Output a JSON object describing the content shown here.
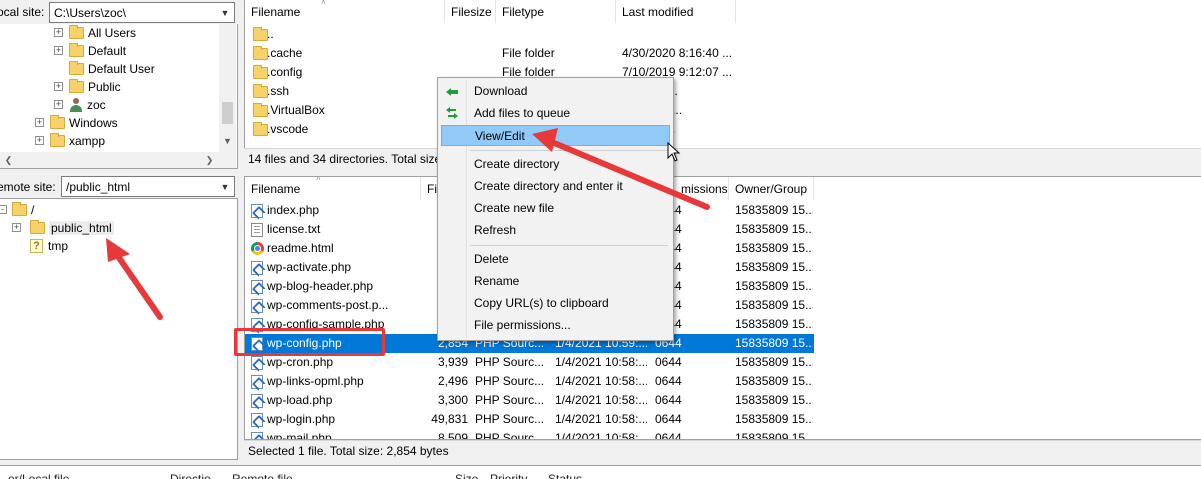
{
  "local": {
    "label": "ocal site:",
    "path": "C:\\Users\\zoc\\",
    "tree": [
      {
        "label": "All Users",
        "icon": "folder-icon",
        "expander": "+"
      },
      {
        "label": "Default",
        "icon": "folder-icon",
        "expander": "+"
      },
      {
        "label": "Default User",
        "icon": "folder-icon",
        "expander": ""
      },
      {
        "label": "Public",
        "icon": "folder-icon",
        "expander": "+"
      },
      {
        "label": "zoc",
        "icon": "user-icon",
        "expander": "+"
      },
      {
        "label": "Windows",
        "icon": "folder-icon",
        "expander": "+"
      },
      {
        "label": "xampp",
        "icon": "folder-icon",
        "expander": "+"
      }
    ],
    "list_headers": [
      "Filename",
      "Filesize",
      "Filetype",
      "Last modified"
    ],
    "files": [
      {
        "name": "..",
        "size": "",
        "type": "",
        "modified": ""
      },
      {
        "name": ".cache",
        "size": "",
        "type": "File folder",
        "modified": "4/30/2020 8:16:40 ..."
      },
      {
        "name": ".config",
        "size": "",
        "type": "File folder",
        "modified": "7/10/2019 9:12:07 ..."
      },
      {
        "name": ".ssh",
        "size": "",
        "type": "",
        "modified": "11:42:46..."
      },
      {
        "name": ".VirtualBox",
        "size": "",
        "type": "",
        "modified": "0 2:59:51..."
      },
      {
        "name": ".vscode",
        "size": "",
        "type": "",
        "modified": "9:14:20 ..."
      }
    ],
    "status": "14 files and 34 directories. Total size:"
  },
  "remote": {
    "label": "emote site:",
    "path": "/public_html",
    "tree": [
      {
        "label": "/",
        "icon": "folder-icon",
        "expander": "-"
      },
      {
        "label": "public_html",
        "icon": "folder-icon",
        "expander": "+"
      },
      {
        "label": "tmp",
        "icon": "unknown-icon",
        "expander": ""
      }
    ],
    "list_headers": [
      "Filename",
      "Fi",
      "",
      "missions",
      "Owner/Group"
    ],
    "files": [
      {
        "name": "index.php",
        "icon": "php",
        "size": "",
        "type": "",
        "modified": "",
        "perms": "0644",
        "owner": "15835809 15..."
      },
      {
        "name": "license.txt",
        "icon": "txt",
        "size": "19",
        "type": "",
        "modified": "",
        "perms": "0644",
        "owner": "15835809 15..."
      },
      {
        "name": "readme.html",
        "icon": "chrome",
        "size": "",
        "type": "",
        "modified": "",
        "perms": "0644",
        "owner": "15835809 15..."
      },
      {
        "name": "wp-activate.php",
        "icon": "php",
        "size": "",
        "type": "",
        "modified": "",
        "perms": "0644",
        "owner": "15835809 15..."
      },
      {
        "name": "wp-blog-header.php",
        "icon": "php",
        "size": "",
        "type": "",
        "modified": "",
        "perms": "0644",
        "owner": "15835809 15..."
      },
      {
        "name": "wp-comments-post.p...",
        "icon": "php",
        "size": "2",
        "type": "",
        "modified": "",
        "perms": "0644",
        "owner": "15835809 15..."
      },
      {
        "name": "wp-config-sample.php",
        "icon": "php",
        "size": "2",
        "type": "",
        "modified": "",
        "perms": "0644",
        "owner": "15835809 15..."
      },
      {
        "name": "wp-config.php",
        "icon": "php",
        "size": "2,854",
        "type": "PHP Sourc...",
        "modified": "1/4/2021 10:59:...",
        "perms": "0644",
        "owner": "15835809 15...",
        "selected": true
      },
      {
        "name": "wp-cron.php",
        "icon": "php",
        "size": "3,939",
        "type": "PHP Sourc...",
        "modified": "1/4/2021 10:58:...",
        "perms": "0644",
        "owner": "15835809 15..."
      },
      {
        "name": "wp-links-opml.php",
        "icon": "php",
        "size": "2,496",
        "type": "PHP Sourc...",
        "modified": "1/4/2021 10:58:...",
        "perms": "0644",
        "owner": "15835809 15..."
      },
      {
        "name": "wp-load.php",
        "icon": "php",
        "size": "3,300",
        "type": "PHP Sourc...",
        "modified": "1/4/2021 10:58:...",
        "perms": "0644",
        "owner": "15835809 15..."
      },
      {
        "name": "wp-login.php",
        "icon": "php",
        "size": "49,831",
        "type": "PHP Sourc...",
        "modified": "1/4/2021 10:58:...",
        "perms": "0644",
        "owner": "15835809 15..."
      },
      {
        "name": "wp-mail.php",
        "icon": "php",
        "size": "8,509",
        "type": "PHP Sourc...",
        "modified": "1/4/2021 10:58:...",
        "perms": "0644",
        "owner": "15835809 15..."
      }
    ],
    "status": "Selected 1 file. Total size: 2,854 bytes"
  },
  "context_menu": {
    "items": [
      {
        "label": "Download",
        "icon": "download-arrow-icon"
      },
      {
        "label": "Add files to queue",
        "icon": "queue-arrow-icon"
      },
      {
        "label": "View/Edit",
        "icon": "",
        "highlighted": true
      },
      {
        "separator": true
      },
      {
        "label": "Create directory"
      },
      {
        "label": "Create directory and enter it"
      },
      {
        "label": "Create new file"
      },
      {
        "label": "Refresh"
      },
      {
        "separator": true
      },
      {
        "label": "Delete"
      },
      {
        "label": "Rename"
      },
      {
        "label": "Copy URL(s) to clipboard"
      },
      {
        "label": "File permissions..."
      }
    ]
  },
  "queue_headers": [
    "er/Local file",
    "Directio",
    "Remote file",
    "Size",
    "Priority",
    "Status"
  ],
  "colors": {
    "selection": "#0078d7",
    "menu_highlight": "#91c9f7",
    "annotation_red": "#e7383a",
    "folder": "#f7d26a"
  }
}
